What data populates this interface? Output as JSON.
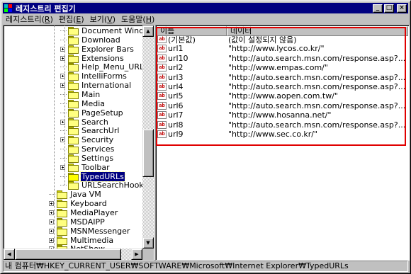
{
  "window": {
    "title": "레지스트리 편집기",
    "minimize": "_",
    "maximize": "□",
    "close": "×"
  },
  "menu": [
    {
      "label": "레지스트리(",
      "key": "R",
      "end": ")"
    },
    {
      "label": "편집(",
      "key": "E",
      "end": ")"
    },
    {
      "label": "보기(",
      "key": "V",
      "end": ")"
    },
    {
      "label": "도움말(",
      "key": "H",
      "end": ")"
    }
  ],
  "tree": {
    "items": [
      {
        "label": "Document Windows",
        "expandable": false,
        "level": 2
      },
      {
        "label": "Download",
        "expandable": false,
        "level": 2
      },
      {
        "label": "Explorer Bars",
        "expandable": true,
        "level": 2
      },
      {
        "label": "Extensions",
        "expandable": true,
        "level": 2
      },
      {
        "label": "Help_Menu_URLs",
        "expandable": false,
        "level": 2
      },
      {
        "label": "IntelliForms",
        "expandable": true,
        "level": 2
      },
      {
        "label": "International",
        "expandable": true,
        "level": 2
      },
      {
        "label": "Main",
        "expandable": false,
        "level": 2
      },
      {
        "label": "Media",
        "expandable": false,
        "level": 2
      },
      {
        "label": "PageSetup",
        "expandable": false,
        "level": 2
      },
      {
        "label": "Search",
        "expandable": true,
        "level": 2
      },
      {
        "label": "SearchUrl",
        "expandable": false,
        "level": 2
      },
      {
        "label": "Security",
        "expandable": true,
        "level": 2
      },
      {
        "label": "Services",
        "expandable": false,
        "level": 2
      },
      {
        "label": "Settings",
        "expandable": false,
        "level": 2
      },
      {
        "label": "Toolbar",
        "expandable": true,
        "level": 2
      },
      {
        "label": "TypedURLs",
        "expandable": false,
        "level": 2,
        "selected": true
      },
      {
        "label": "URLSearchHooks",
        "expandable": false,
        "level": 2
      },
      {
        "label": "Java VM",
        "expandable": false,
        "level": 1
      },
      {
        "label": "Keyboard",
        "expandable": true,
        "level": 1
      },
      {
        "label": "MediaPlayer",
        "expandable": true,
        "level": 1
      },
      {
        "label": "MSDAIPP",
        "expandable": true,
        "level": 1
      },
      {
        "label": "MSNMessenger",
        "expandable": true,
        "level": 1
      },
      {
        "label": "Multimedia",
        "expandable": true,
        "level": 1
      },
      {
        "label": "NetShow",
        "expandable": true,
        "level": 1
      }
    ]
  },
  "list": {
    "columns": [
      "이름",
      "데이터"
    ],
    "rows": [
      {
        "name": "(기본값)",
        "data": "(값이 설정되지 않음)"
      },
      {
        "name": "url1",
        "data": "\"http://www.lycos.co.kr/\""
      },
      {
        "name": "url10",
        "data": "\"http://auto.search.msn.com/response.asp?..."
      },
      {
        "name": "url2",
        "data": "\"http://www.empas.com/\""
      },
      {
        "name": "url3",
        "data": "\"http://auto.search.msn.com/response.asp?..."
      },
      {
        "name": "url4",
        "data": "\"http://auto.search.msn.com/response.asp?..."
      },
      {
        "name": "url5",
        "data": "\"http://www.aopen.com.tw/\""
      },
      {
        "name": "url6",
        "data": "\"http://auto.search.msn.com/response.asp?..."
      },
      {
        "name": "url7",
        "data": "\"http://www.hosanna.net/\""
      },
      {
        "name": "url8",
        "data": "\"http://auto.search.msn.com/response.asp?..."
      },
      {
        "name": "url9",
        "data": "\"http://www.sec.co.kr/\""
      }
    ],
    "value_icon": "ab"
  },
  "status": {
    "path": "내 컴퓨터₩HKEY_CURRENT_USER₩SOFTWARE₩Microsoft₩Internet Explorer₩TypedURLs"
  },
  "colors": {
    "titlebar": "#000080",
    "selection": "#000080",
    "highlight_box": "#e00000"
  }
}
